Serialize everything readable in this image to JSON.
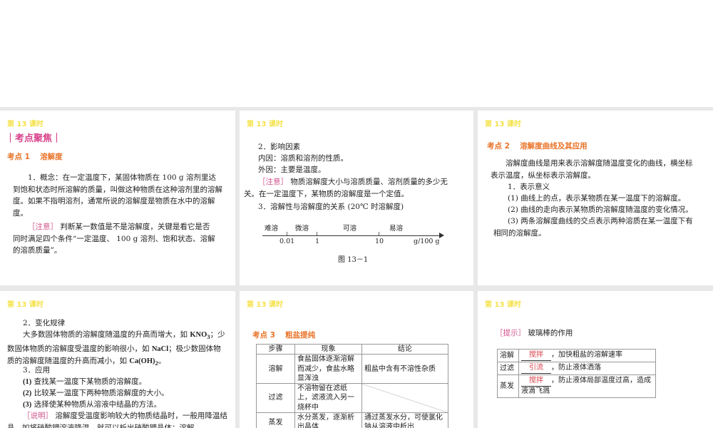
{
  "lesson_label": "第 13 课时",
  "p1": {
    "heading": "｜考点聚焦｜",
    "section": "考点 1　 溶解度",
    "concept": "1．概念：在一定温度下，某固体物质在 100 g 溶剂里达到饱和状态时所溶解的质量，叫做这种物质在这种溶剂里的溶解度。如果不指明溶剂，通常所说的溶解度是物质在水中的溶解度。",
    "note_tag": "［注意］",
    "note": " 判断某一数值是不是溶解度，关键是看它是否同时满足四个条件“一定温度、 100 g 溶剂、饱和状态、溶解的溶质质量”。"
  },
  "p2": {
    "l1": "2．影响因素",
    "l2": "内因：溶质和溶剂的性质。",
    "l3": "外因：主要是温度。",
    "note_tag": "［注意］",
    "note": " 物质溶解度大小与溶质质量、溶剂质量的多少无关。在一定温度下，某物质的溶解度是一个定值。",
    "l4": "3．溶解性与溶解度的关系 (20℃ 时溶解度)",
    "scale": {
      "labels": [
        "难溶",
        "微溶",
        "可溶",
        "易溶"
      ],
      "ticks": [
        "0.01",
        "1",
        "10"
      ],
      "unit": "g/100 g"
    },
    "caption": "图 13－1"
  },
  "p3": {
    "section": "考点 2　 溶解度曲线及其应用",
    "intro": "溶解度曲线是用来表示溶解度随温度变化的曲线，横坐标表示温度，纵坐标表示溶解度。",
    "l1": "1．表示意义",
    "l2": "(1) 曲线上的点，表示某物质在某一温度下的溶解度。",
    "l3": "(2) 曲线的走向表示某物质的溶解度随温度的变化情况。",
    "l4": "(3) 两条溶解度曲线的交点表示两种溶质在某一温度下有相同的溶解度。"
  },
  "p4": {
    "l1": "2．变化规律",
    "l2a": "大多数固体物质的溶解度随温度的升高而增大，如 ",
    "kno3": "KNO",
    "kno3_sub": "3",
    "l2b": "；少数固体物质的溶解度受温度的影响很小，如 ",
    "nacl": "NaCl",
    "l2c": "；极少数固体物质的溶解度随温度的升高而减小，如 ",
    "caoh": "Ca(OH)",
    "caoh_sub": "2",
    "l2d": "。",
    "l3": "3．应用",
    "a1n": "(1)",
    "a1": " 查找某一温度下某物质的溶解度。",
    "a2n": "(2)",
    "a2": " 比较某一温度下两种物质溶解度的大小。",
    "a3n": "(3)",
    "a3": " 选择使某种物质从溶液中结晶的方法。",
    "note_tag": "［说明］",
    "note": " 溶解度受温度影响较大的物质结晶时，一般用降温结晶，如将硝酸钾溶液降温，就可以析出硝酸钾晶体；溶解"
  },
  "p5": {
    "section": "考点 3　 粗盐提纯",
    "headers": [
      "步骤",
      "现象",
      "结论"
    ],
    "rows": [
      [
        "溶解",
        "食盐固体逐渐溶解而减少，食盐水略显浑浊",
        "粗盐中含有不溶性杂质"
      ],
      [
        "过滤",
        "不溶物留在滤纸上，滤液流入另一烧杯中",
        ""
      ],
      [
        "蒸发",
        "水分蒸发，逐渐析出晶体",
        "通过蒸发水分，可使氯化钠从溶液中析出"
      ]
    ]
  },
  "p6": {
    "tip_tag": "［提示］",
    "tip": " 玻璃棒的作用",
    "rows": [
      {
        "step": "溶解",
        "answer": "搅拌",
        "text": "，加快粗盐的溶解速率"
      },
      {
        "step": "过滤",
        "answer": "引流",
        "text": "，防止液体洒落"
      },
      {
        "step": "蒸发",
        "answer": "搅拌",
        "text": "，防止液体局部温度过高，造成液滴飞溅"
      }
    ]
  }
}
